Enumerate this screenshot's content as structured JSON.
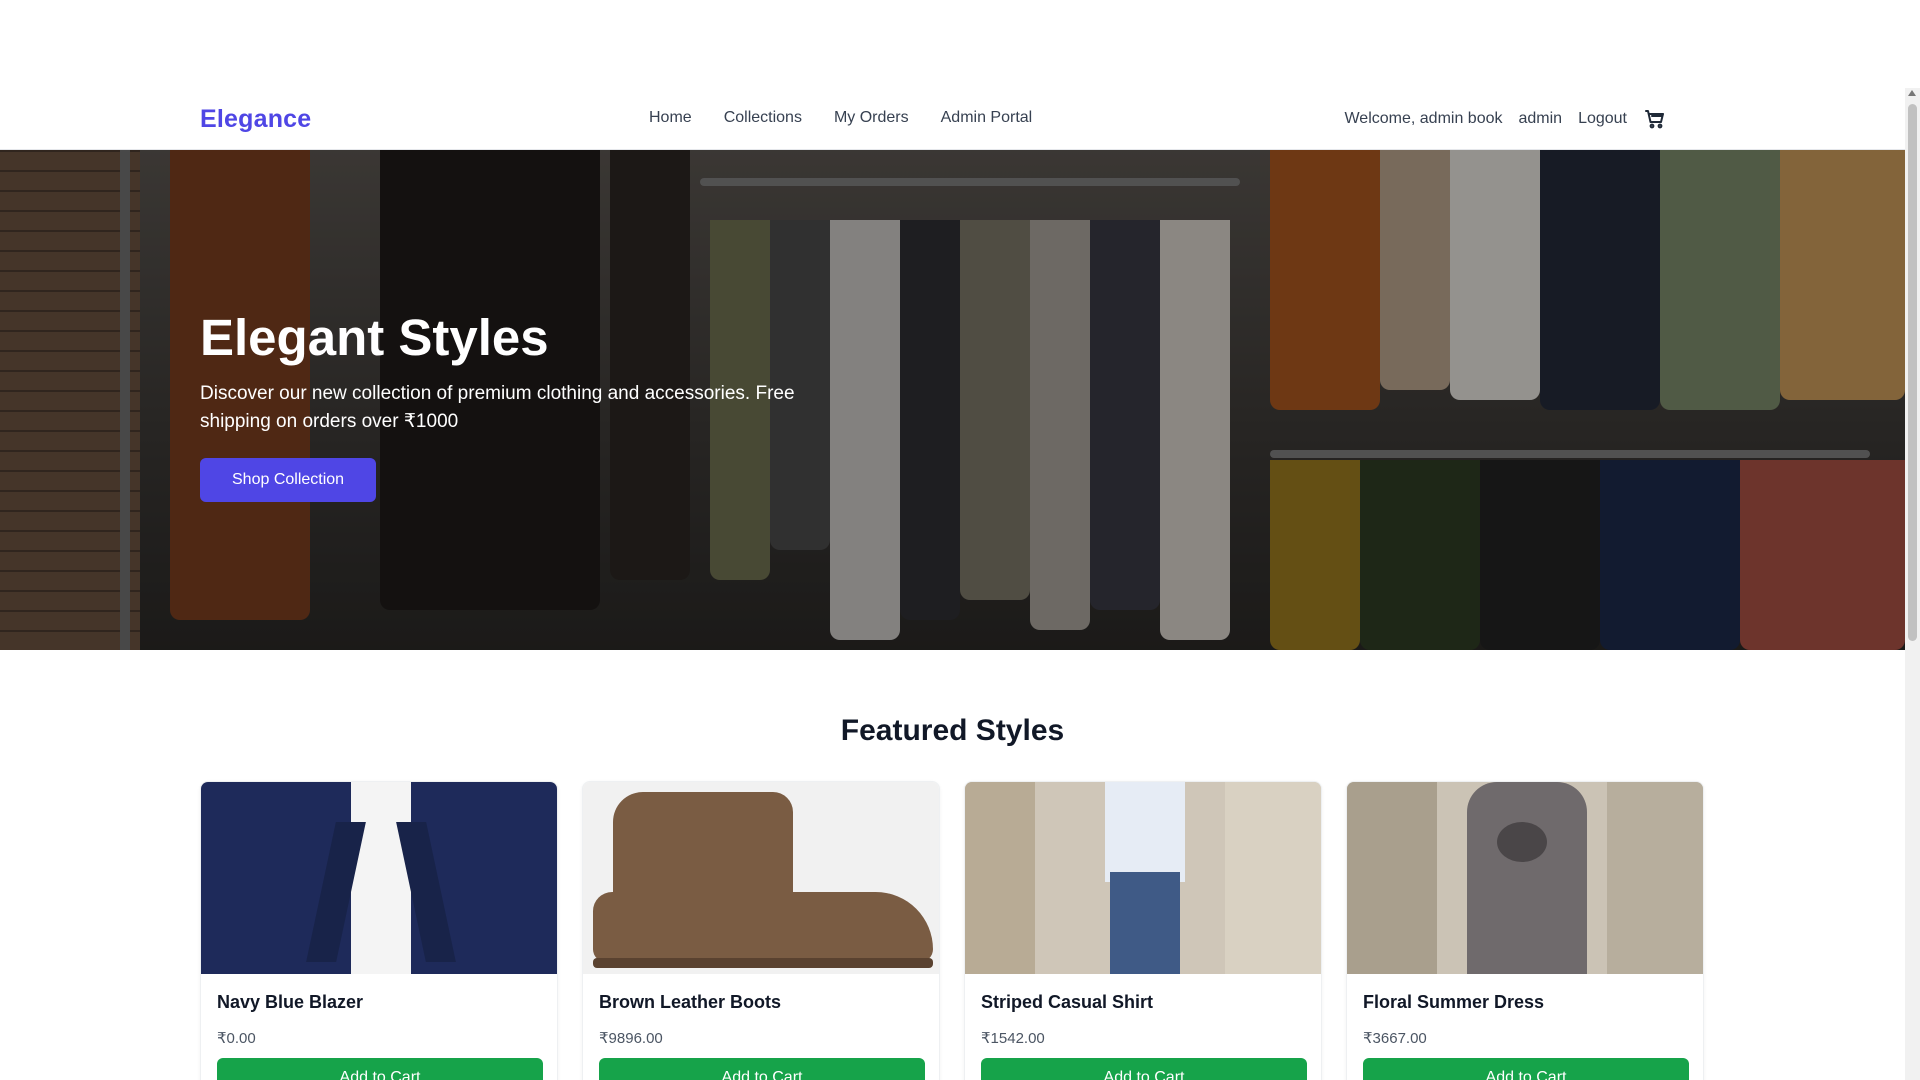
{
  "navbar": {
    "brand": "Elegance",
    "links": [
      "Home",
      "Collections",
      "My Orders",
      "Admin Portal"
    ],
    "welcome": "Welcome, admin book",
    "user": "admin",
    "logout": "Logout",
    "cart_icon": "shopping-cart-icon"
  },
  "hero": {
    "title": "Elegant Styles",
    "subtitle": "Discover our new collection of premium clothing and accessories. Free shipping on orders over ₹1000",
    "button": "Shop Collection"
  },
  "featured": {
    "title": "Featured Styles",
    "products": [
      {
        "name": "Navy Blue Blazer",
        "price": "₹0.00",
        "button": "Add to Cart"
      },
      {
        "name": "Brown Leather Boots",
        "price": "₹9896.00",
        "button": "Add to Cart"
      },
      {
        "name": "Striped Casual Shirt",
        "price": "₹1542.00",
        "button": "Add to Cart"
      },
      {
        "name": "Floral Summer Dress",
        "price": "₹3667.00",
        "button": "Add to Cart"
      }
    ]
  },
  "colors": {
    "brand": "#4f46e5",
    "primary_button": "#4f46e5",
    "cart_button": "#16a34a"
  }
}
